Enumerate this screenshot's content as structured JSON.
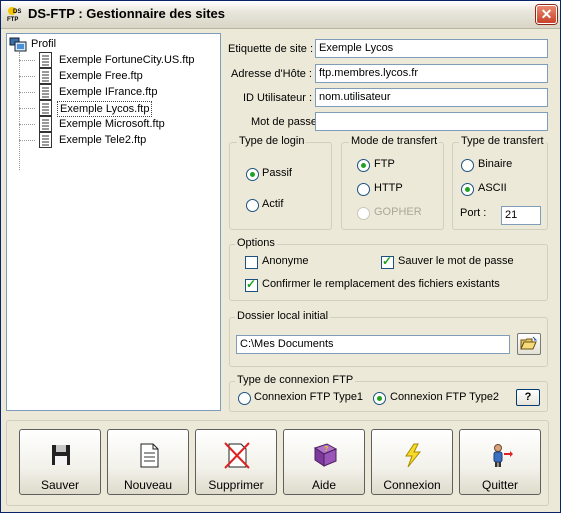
{
  "window": {
    "title": "DS-FTP : Gestionnaire des sites",
    "app_icon_text": "DS\nFTP"
  },
  "tree": {
    "root_label": "Profil",
    "items": [
      {
        "label": "Exemple FortuneCity.US.ftp",
        "selected": false
      },
      {
        "label": "Exemple Free.ftp",
        "selected": false
      },
      {
        "label": "Exemple IFrance.ftp",
        "selected": false
      },
      {
        "label": "Exemple Lycos.ftp",
        "selected": true
      },
      {
        "label": "Exemple Microsoft.ftp",
        "selected": false
      },
      {
        "label": "Exemple Tele2.ftp",
        "selected": false
      }
    ]
  },
  "form": {
    "site_label": "Etiquette de site :",
    "site_value": "Exemple Lycos",
    "host_label": "Adresse d'Hôte :",
    "host_value": "ftp.membres.lycos.fr",
    "user_label": "ID Utilisateur :",
    "user_value": "nom.utilisateur",
    "pass_label": "Mot de passe :",
    "pass_value": ""
  },
  "login_type": {
    "title": "Type de login",
    "passif": "Passif",
    "actif": "Actif",
    "selected": "Passif"
  },
  "transfer_mode": {
    "title": "Mode de transfert",
    "ftp": "FTP",
    "http": "HTTP",
    "gopher": "GOPHER",
    "selected": "FTP"
  },
  "transfer_type": {
    "title": "Type de transfert",
    "binaire": "Binaire",
    "ascii": "ASCII",
    "selected": "ASCII",
    "port_label": "Port :",
    "port_value": "21"
  },
  "options": {
    "title": "Options",
    "anonyme": "Anonyme",
    "anonyme_checked": false,
    "save_pass": "Sauver le mot de passe",
    "save_pass_checked": true,
    "confirm": "Confirmer le remplacement des fichiers existants",
    "confirm_checked": true
  },
  "local_folder": {
    "title": "Dossier local initial",
    "value": "C:\\Mes Documents"
  },
  "connection_type": {
    "title": "Type de connexion FTP",
    "type1": "Connexion FTP Type1",
    "type2": "Connexion FTP Type2",
    "selected": "Type2",
    "help": "?"
  },
  "buttons": {
    "save": "Sauver",
    "new": "Nouveau",
    "delete": "Supprimer",
    "help": "Aide",
    "connect": "Connexion",
    "quit": "Quitter"
  },
  "colors": {
    "accent_green": "#21A121",
    "close_red": "#C8422A",
    "field_border": "#7F9DB9"
  }
}
